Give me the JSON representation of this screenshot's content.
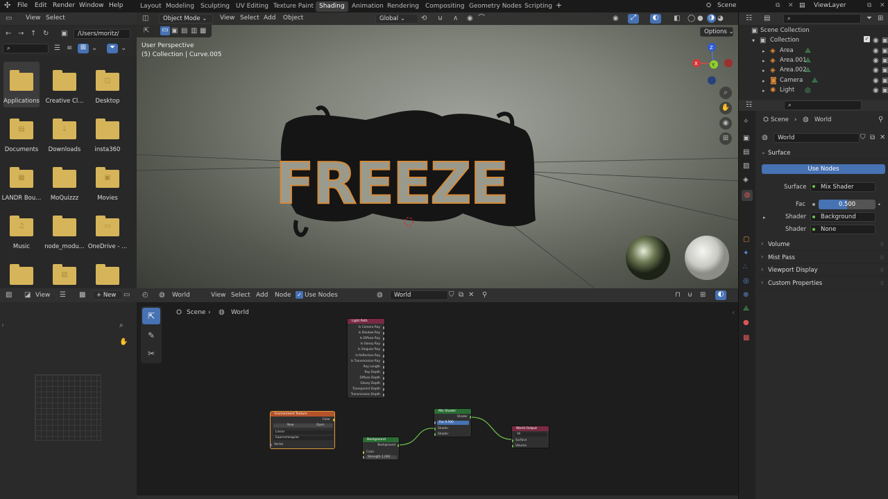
{
  "menu": {
    "file": "File",
    "edit": "Edit",
    "render": "Render",
    "window": "Window",
    "help": "Help"
  },
  "workspaces": [
    "Layout",
    "Modeling",
    "Sculpting",
    "UV Editing",
    "Texture Paint",
    "Shading",
    "Animation",
    "Rendering",
    "Compositing",
    "Geometry Nodes",
    "Scripting"
  ],
  "active_workspace": "Shading",
  "scene": {
    "name": "Scene",
    "view_layer": "ViewLayer"
  },
  "filebrowser": {
    "view": "View",
    "select": "Select",
    "path": "/Users/moritz/",
    "items": [
      {
        "name": "Applications",
        "selected": true
      },
      {
        "name": "Creative Cl..."
      },
      {
        "name": "Desktop"
      },
      {
        "name": "Documents"
      },
      {
        "name": "Downloads"
      },
      {
        "name": "insta360"
      },
      {
        "name": "LANDR Bou..."
      },
      {
        "name": "MoQuizzz"
      },
      {
        "name": "Movies"
      },
      {
        "name": "Music"
      },
      {
        "name": "node_modu..."
      },
      {
        "name": "OneDrive - ..."
      },
      {
        "name": ""
      },
      {
        "name": ""
      },
      {
        "name": ""
      }
    ]
  },
  "viewport": {
    "mode": "Object Mode",
    "view": "View",
    "select": "Select",
    "add": "Add",
    "object": "Object",
    "orientation": "Global",
    "options": "Options",
    "perspective": "User Perspective",
    "collection_info": "(5) Collection | Curve.005",
    "text3d": "FREEZE",
    "gizmo": {
      "x": "X",
      "y": "Y",
      "z": "Z"
    }
  },
  "imageeditor": {
    "view": "View",
    "new": "New"
  },
  "nodeeditor": {
    "world_menu": "World",
    "view": "View",
    "select": "Select",
    "add": "Add",
    "node": "Node",
    "use_nodes": "Use Nodes",
    "world_name": "World",
    "breadcrumb": {
      "scene": "Scene",
      "world": "World"
    },
    "nodes": {
      "light_path": {
        "title": "Light Path",
        "outputs": [
          "Is Camera Ray",
          "Is Shadow Ray",
          "Is Diffuse Ray",
          "Is Glossy Ray",
          "Is Singular Ray",
          "Is Reflection Ray",
          "Is Transmission Ray",
          "Ray Length",
          "Ray Depth",
          "Diffuse Depth",
          "Glossy Depth",
          "Transparent Depth",
          "Transmission Depth"
        ]
      },
      "env_texture": {
        "title": "Environment Texture",
        "output": "Color",
        "new": "New",
        "open": "Open",
        "interp": "Linear",
        "proj": "Equirectangular",
        "input": "Vector"
      },
      "background": {
        "title": "Background",
        "output": "Background",
        "color": "Color",
        "strength_label": "Strength",
        "strength": "1.000"
      },
      "mix_shader": {
        "title": "Mix Shader",
        "output": "Shader",
        "fac_label": "Fac",
        "fac": "0.500",
        "in1": "Shader",
        "in2": "Shader"
      },
      "world_output": {
        "title": "World Output",
        "target": "All",
        "surface": "Surface",
        "volume": "Volume"
      }
    }
  },
  "outliner": {
    "root": "Scene Collection",
    "collection": "Collection",
    "items": [
      "Area",
      "Area.001",
      "Area.002",
      "Camera",
      "Light"
    ]
  },
  "properties": {
    "breadcrumb_scene": "Scene",
    "breadcrumb_world": "World",
    "world_name": "World",
    "surface_section": "Surface",
    "use_nodes": "Use Nodes",
    "surface_label": "Surface",
    "surface_value": "Mix Shader",
    "fac_label": "Fac",
    "fac_value": "0.500",
    "fac_fraction": 0.5,
    "shader1_label": "Shader",
    "shader1_value": "Background",
    "shader2_label": "Shader",
    "shader2_value": "None",
    "sections": [
      "Volume",
      "Mist Pass",
      "Viewport Display",
      "Custom Properties"
    ]
  },
  "colors": {
    "accent": "#4772b3",
    "node_orange": "#b5522a",
    "node_green": "#2a6d34",
    "node_pink": "#7a2a43",
    "folder": "#d6b55a"
  }
}
